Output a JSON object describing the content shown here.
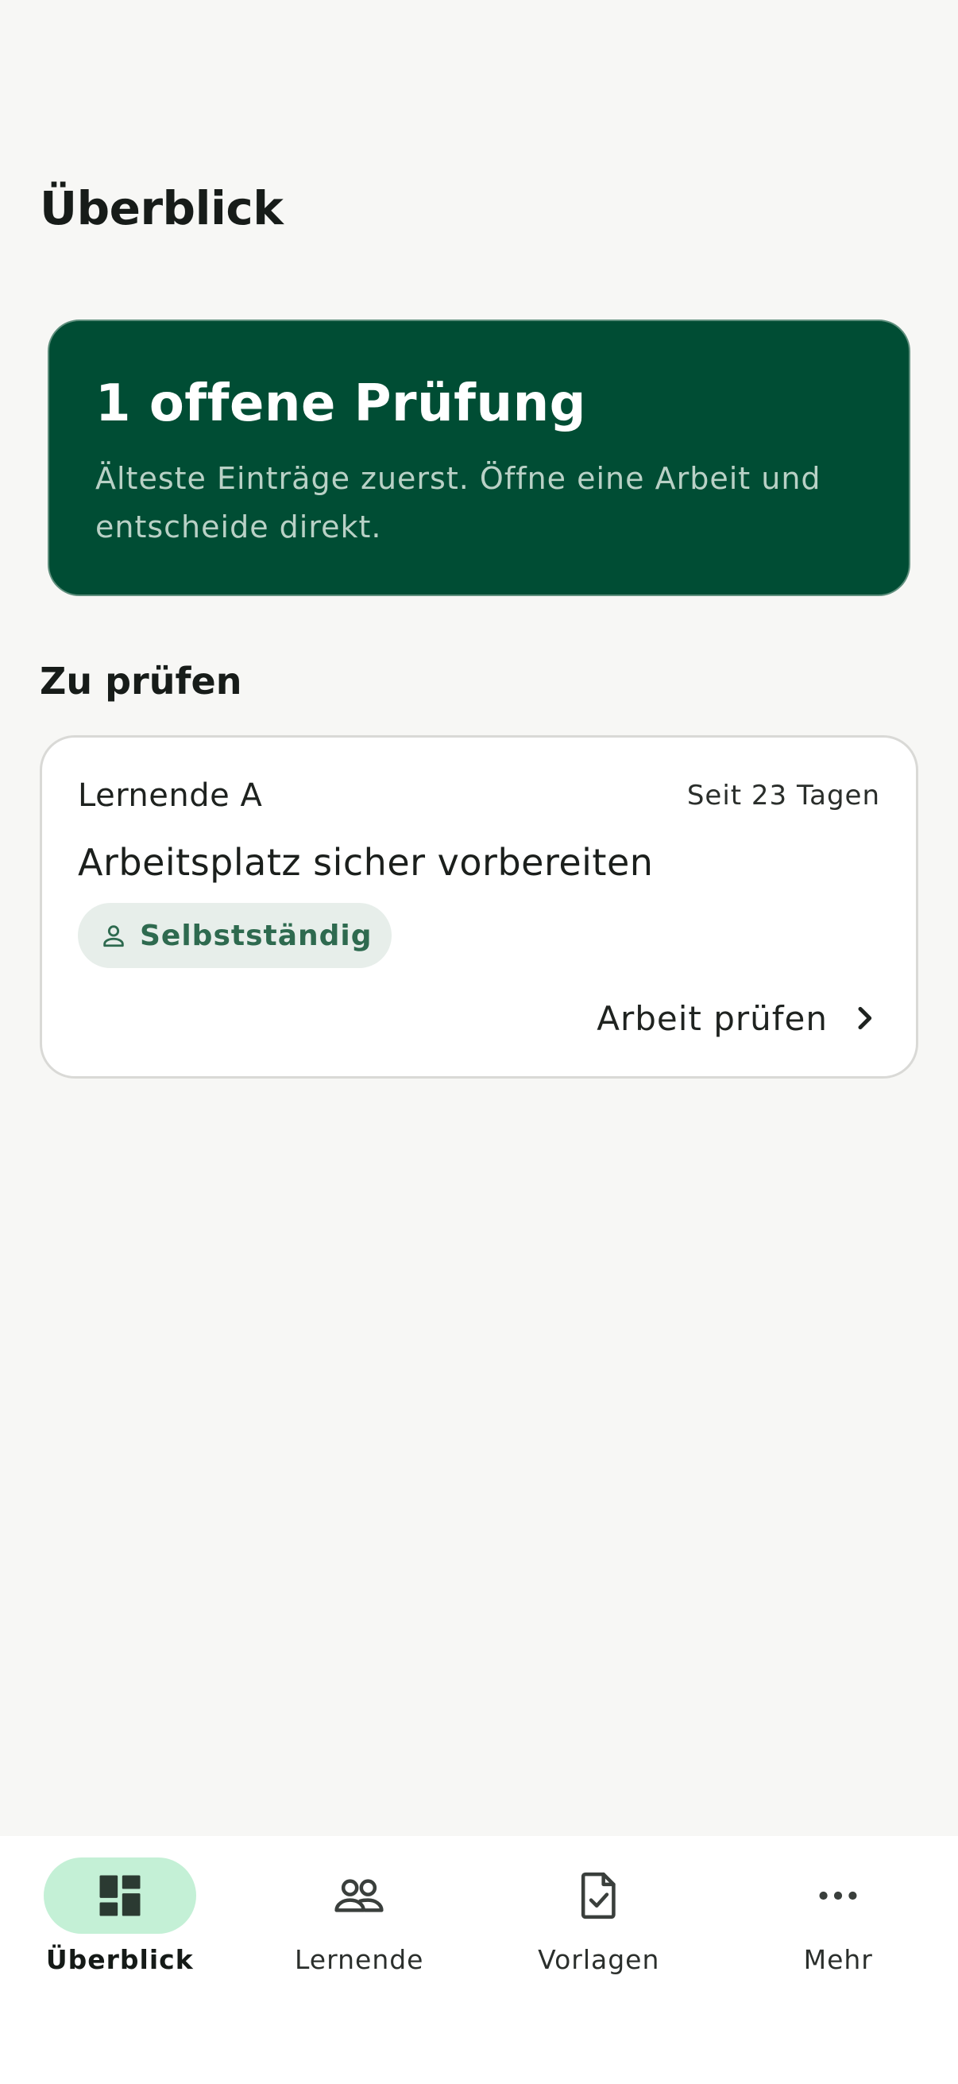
{
  "header": {
    "title": "Überblick"
  },
  "hero": {
    "title": "1 offene Prüfung",
    "subtitle": "Älteste Einträge zuerst. Öffne eine Arbeit und entscheide direkt."
  },
  "section": {
    "title": "Zu prüfen"
  },
  "review_items": [
    {
      "learner": "Lernende A",
      "since": "Seit 23 Tagen",
      "task": "Arbeitsplatz sicher vorbereiten",
      "tag": "Selbstständig",
      "tag_icon": "person-icon",
      "action": "Arbeit prüfen",
      "action_icon": "chevron-right-icon"
    }
  ],
  "nav": {
    "active": "Überblick",
    "items": [
      {
        "label": "Überblick",
        "icon": "dashboard-icon"
      },
      {
        "label": "Lernende",
        "icon": "people-icon"
      },
      {
        "label": "Vorlagen",
        "icon": "document-check-icon"
      },
      {
        "label": "Mehr",
        "icon": "more-horizontal-icon"
      }
    ]
  },
  "colors": {
    "background": "#f7f7f5",
    "hero": "#004d34",
    "accent_pill": "#c4f0d6",
    "chip_bg": "#e7eeea",
    "chip_text": "#2e6a4f"
  }
}
